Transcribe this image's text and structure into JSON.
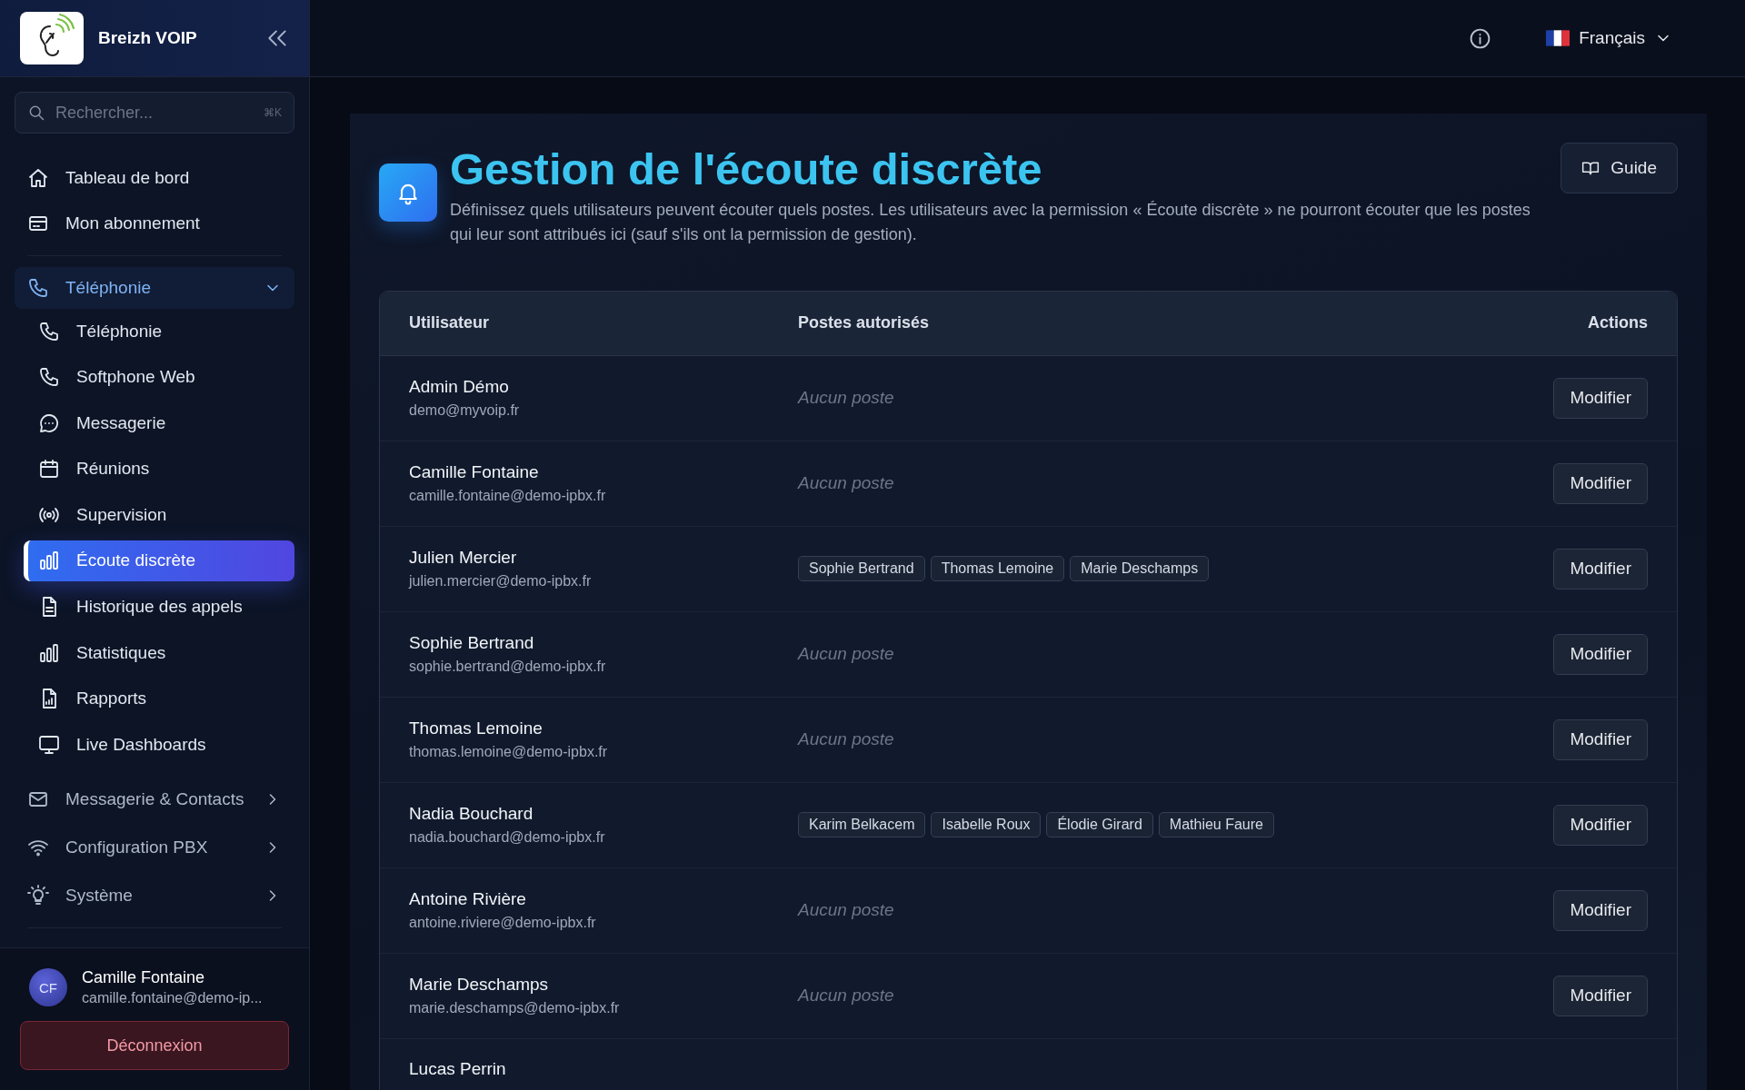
{
  "sidebar": {
    "brand": "Breizh VOIP",
    "search": {
      "placeholder": "Rechercher...",
      "shortcut": "⌘K"
    },
    "items": [
      {
        "label": "Tableau de bord",
        "kind": "link",
        "selected": false
      },
      {
        "label": "Mon abonnement",
        "kind": "link",
        "selected": false
      },
      {
        "label": "Téléphonie",
        "kind": "group",
        "expanded": true,
        "children": [
          {
            "label": "Téléphonie",
            "selected": false
          },
          {
            "label": "Softphone Web",
            "selected": false
          },
          {
            "label": "Messagerie",
            "selected": false
          },
          {
            "label": "Réunions",
            "selected": false
          },
          {
            "label": "Supervision",
            "selected": false
          },
          {
            "label": "Écoute discrète",
            "selected": true
          },
          {
            "label": "Historique des appels",
            "selected": false
          },
          {
            "label": "Statistiques",
            "selected": false
          },
          {
            "label": "Rapports",
            "selected": false
          },
          {
            "label": "Live Dashboards",
            "selected": false
          }
        ]
      },
      {
        "label": "Messagerie & Contacts",
        "kind": "group",
        "expanded": false
      },
      {
        "label": "Configuration PBX",
        "kind": "group",
        "expanded": false
      },
      {
        "label": "Système",
        "kind": "group",
        "expanded": false
      }
    ],
    "user": {
      "initials": "CF",
      "name": "Camille Fontaine",
      "email": "camille.fontaine@demo-ip..."
    },
    "logout": "Déconnexion"
  },
  "header": {
    "language": "Français"
  },
  "page": {
    "title": "Gestion de l'écoute discrète",
    "description": "Définissez quels utilisateurs peuvent écouter quels postes. Les utilisateurs avec la permission « Écoute discrète » ne pourront écouter que les postes qui leur sont attribués ici (sauf s'ils ont la permission de gestion).",
    "guide": "Guide"
  },
  "table": {
    "columns": [
      "Utilisateur",
      "Postes autorisés",
      "Actions"
    ],
    "rows": [
      {
        "name": "Admin Démo",
        "email": "demo@myvoip.fr",
        "empty_text": "Aucun poste",
        "action": "Modifier"
      },
      {
        "name": "Camille Fontaine",
        "email": "camille.fontaine@demo-ipbx.fr",
        "empty_text": "Aucun poste",
        "action": "Modifier"
      },
      {
        "name": "Julien Mercier",
        "email": "julien.mercier@demo-ipbx.fr",
        "extensions": [
          "Sophie Bertrand",
          "Thomas Lemoine",
          "Marie Deschamps"
        ],
        "action": "Modifier"
      },
      {
        "name": "Sophie Bertrand",
        "email": "sophie.bertrand@demo-ipbx.fr",
        "empty_text": "Aucun poste",
        "action": "Modifier"
      },
      {
        "name": "Thomas Lemoine",
        "email": "thomas.lemoine@demo-ipbx.fr",
        "empty_text": "Aucun poste",
        "action": "Modifier"
      },
      {
        "name": "Nadia Bouchard",
        "email": "nadia.bouchard@demo-ipbx.fr",
        "extensions": [
          "Karim Belkacem",
          "Isabelle Roux",
          "Élodie Girard",
          "Mathieu Faure"
        ],
        "action": "Modifier"
      },
      {
        "name": "Antoine Rivière",
        "email": "antoine.riviere@demo-ipbx.fr",
        "empty_text": "Aucun poste",
        "action": "Modifier"
      },
      {
        "name": "Marie Deschamps",
        "email": "marie.deschamps@demo-ipbx.fr",
        "empty_text": "Aucun poste",
        "action": "Modifier"
      },
      {
        "name": "Lucas Perrin"
      }
    ]
  }
}
